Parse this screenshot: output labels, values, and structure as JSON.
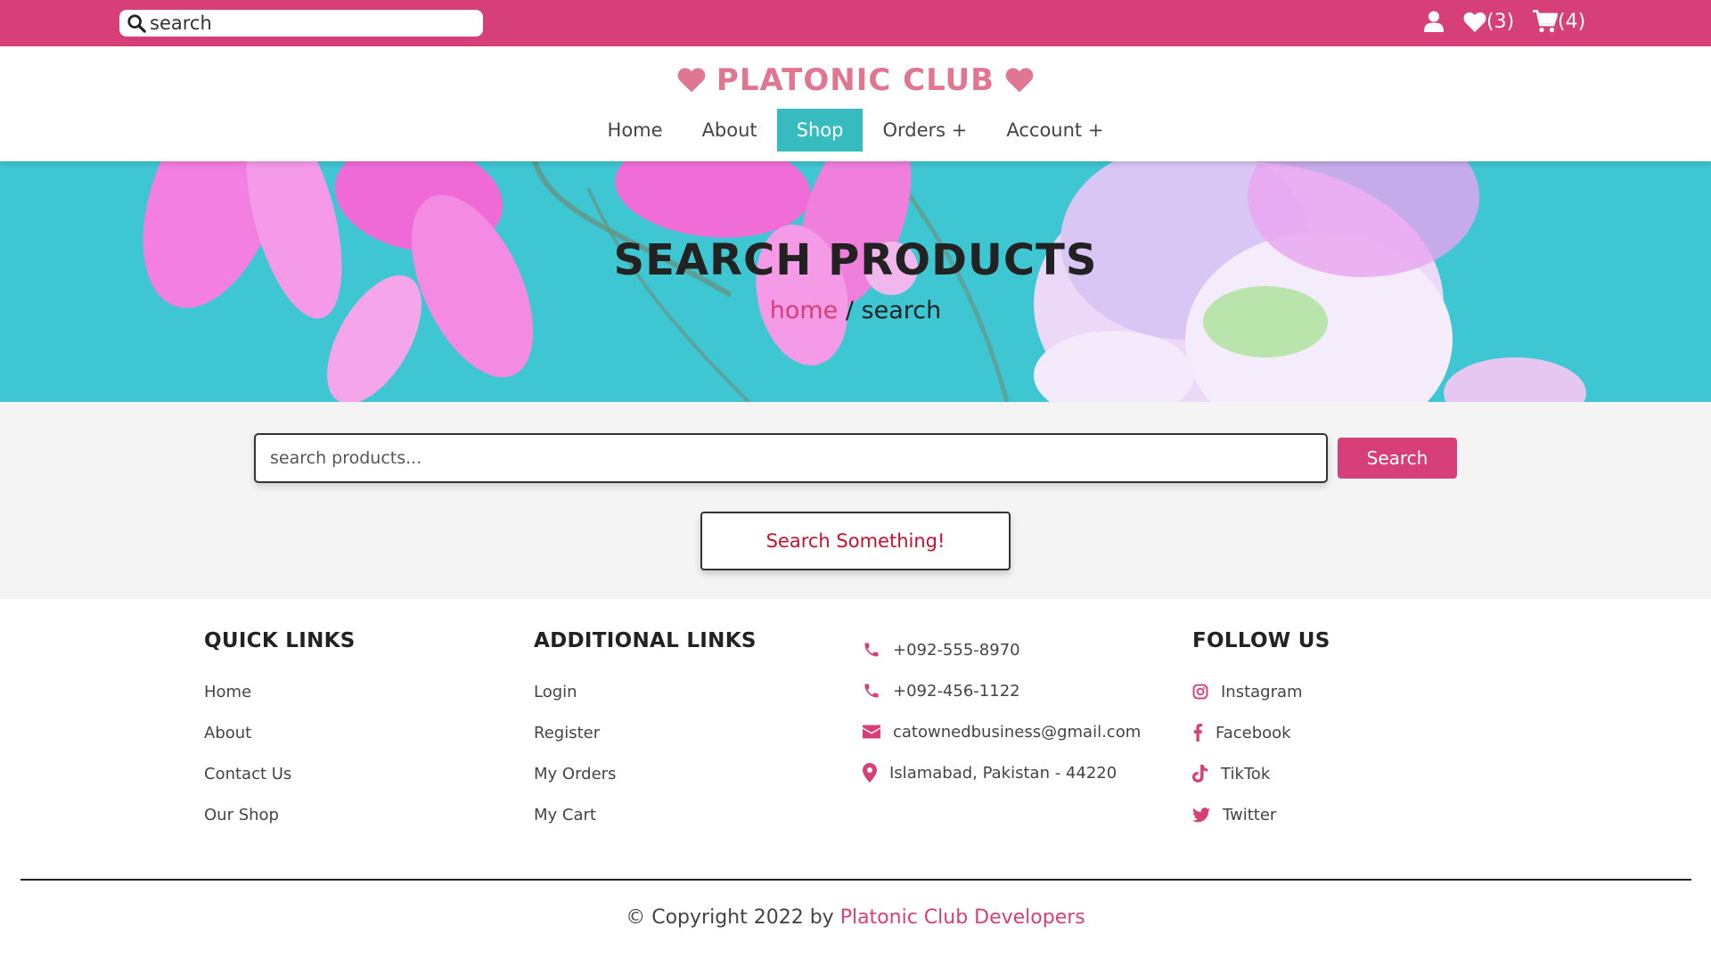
{
  "topbar": {
    "search_placeholder": "search",
    "wishlist_count": "(3)",
    "cart_count": "(4)"
  },
  "header": {
    "logo_text": "PLATONIC CLUB",
    "nav": [
      {
        "label": "Home"
      },
      {
        "label": "About"
      },
      {
        "label": "Shop"
      },
      {
        "label": "Orders +"
      },
      {
        "label": "Account +"
      }
    ]
  },
  "hero": {
    "title": "SEARCH PRODUCTS",
    "breadcrumb_home": "home",
    "breadcrumb_sep": " / ",
    "breadcrumb_current": "search"
  },
  "search": {
    "placeholder": "search products...",
    "button_label": "Search",
    "empty_message": "Search Something!"
  },
  "footer": {
    "quick_links": {
      "heading": "QUICK LINKS",
      "items": [
        "Home",
        "About",
        "Contact Us",
        "Our Shop"
      ]
    },
    "additional_links": {
      "heading": "ADDITIONAL LINKS",
      "items": [
        "Login",
        "Register",
        "My Orders",
        "My Cart"
      ]
    },
    "contact": {
      "phone1": "+092-555-8970",
      "phone2": "+092-456-1122",
      "email": "catownedbusiness@gmail.com",
      "address": "Islamabad, Pakistan - 44220"
    },
    "follow": {
      "heading": "FOLLOW US",
      "items": [
        "Instagram",
        "Facebook",
        "TikTok",
        "Twitter"
      ]
    },
    "copyright_prefix": "© Copyright 2022 by ",
    "copyright_link": "Platonic Club Developers"
  },
  "colors": {
    "brand_pink": "#d63f77",
    "logo_pink": "#e07792",
    "teal_active": "#36bcbf",
    "hero_bg": "#3fc6d3",
    "empty_text_red": "#c8102e"
  }
}
